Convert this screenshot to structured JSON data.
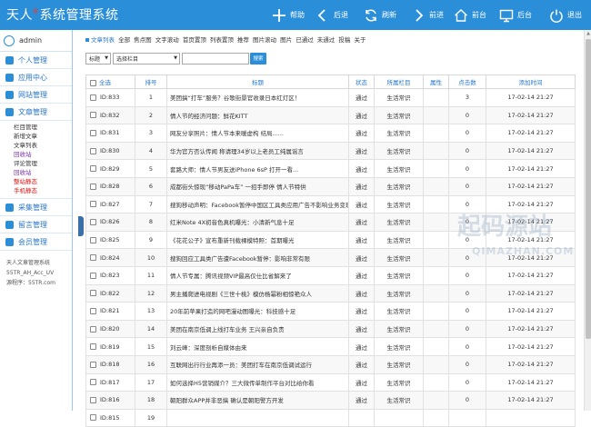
{
  "app": {
    "title_prefix": "天人",
    "title_mark": "®",
    "title_suffix": "系统管理系统"
  },
  "toolbar": [
    {
      "label": "帮助",
      "icon": "plus-icon",
      "name": "help"
    },
    {
      "label": "后退",
      "icon": "back-arrow-icon",
      "name": "back"
    },
    {
      "label": "刷新",
      "icon": "refresh-icon",
      "name": "refresh"
    },
    {
      "label": "前进",
      "icon": "forward-arrow-icon",
      "name": "forward"
    },
    {
      "label": "前台",
      "icon": "home-icon",
      "name": "frontend"
    },
    {
      "label": "后台",
      "icon": "monitor-icon",
      "name": "backend"
    },
    {
      "label": "退出",
      "icon": "power-icon",
      "name": "logout"
    }
  ],
  "sidebar": {
    "user": "admin",
    "menus": [
      "个人管理",
      "应用中心",
      "网站管理",
      "文章管理"
    ],
    "submenu": [
      "栏目管理",
      "新增文章",
      "文章列表",
      "回收站",
      "评论管理",
      "回收站",
      "整站静态",
      "手机静态"
    ],
    "menus2": [
      "采集管理",
      "留言管理",
      "会员管理"
    ],
    "info": [
      "天人文章管理系统",
      "55TR_AH_Acc_UV",
      "源程序：55TR.com"
    ]
  },
  "breadcrumb": {
    "first": "文章列表",
    "links": [
      "全部",
      "焦点图",
      "文字滚动",
      "首页置顶",
      "列表置顶",
      "推荐",
      "图片滚动",
      "图片",
      "已通过",
      "未通过",
      "投稿",
      "关于"
    ]
  },
  "filters": {
    "field": "标题",
    "category": "选择栏目",
    "search_label": "搜索"
  },
  "table": {
    "headers": [
      "全选",
      "排号",
      "标题",
      "状态",
      "所属栏目",
      "属性",
      "点击数",
      "添加时间"
    ],
    "rows": [
      {
        "id": "ID:833",
        "no": "1",
        "title": "美团搞“打车”服务？谷歌街景官收录日本红灯区！",
        "status": "通过",
        "category": "生活常识",
        "attr": "",
        "clicks": "3",
        "time": "17-02-14 21:27"
      },
      {
        "id": "ID:832",
        "no": "2",
        "title": "情人节的经济问题：鲜花KITT",
        "status": "通过",
        "category": "生活常识",
        "attr": "",
        "clicks": "0",
        "time": "17-02-14 21:27"
      },
      {
        "id": "ID:831",
        "no": "3",
        "title": "网友分享照片：情人节本来暖虚构 结局......",
        "status": "通过",
        "category": "生活常识",
        "attr": "",
        "clicks": "0",
        "time": "17-02-14 21:27"
      },
      {
        "id": "ID:830",
        "no": "4",
        "title": "华为官方否认传闻 称请理34岁以上老员工纯属谣言",
        "status": "通过",
        "category": "生活常识",
        "attr": "",
        "clicks": "0",
        "time": "17-02-14 21:27"
      },
      {
        "id": "ID:829",
        "no": "5",
        "title": "套路大师：情人节男友送iPhone 6sP 打开一看...",
        "status": "通过",
        "category": "生活常识",
        "attr": "",
        "clicks": "0",
        "time": "17-02-14 21:27"
      },
      {
        "id": "ID:828",
        "no": "6",
        "title": "成都街头惊现“移动PaPa车” 一招手即停 情人节特供",
        "status": "通过",
        "category": "生活常识",
        "attr": "",
        "clicks": "0",
        "time": "17-02-14 21:27"
      },
      {
        "id": "ID:827",
        "no": "7",
        "title": "搜狗移动声明：Facebook暂停中国区工具类应用广告不影响业务变现",
        "status": "通过",
        "category": "生活常识",
        "attr": "",
        "clicks": "0",
        "time": "17-02-14 21:27"
      },
      {
        "id": "ID:826",
        "no": "8",
        "title": "红米Note 4X初音色真机曝光：小清新气息十足",
        "status": "通过",
        "category": "生活常识",
        "attr": "",
        "clicks": "0",
        "time": "17-02-14 21:27"
      },
      {
        "id": "ID:825",
        "no": "9",
        "title": "《花花公子》宣布重新刊载裸模特照：首期曝光",
        "status": "通过",
        "category": "生活常识",
        "attr": "",
        "clicks": "0",
        "time": "17-02-14 21:27"
      },
      {
        "id": "ID:824",
        "no": "10",
        "title": "搜狗回应工具类广告遭Facebook暂停：影响非常有限",
        "status": "通过",
        "category": "生活常识",
        "attr": "",
        "clicks": "0",
        "time": "17-02-14 21:27"
      },
      {
        "id": "ID:823",
        "no": "11",
        "title": "情人节专属：腾讯视频VIP最高仅仕比省解来了",
        "status": "通过",
        "category": "生活常识",
        "attr": "",
        "clicks": "0",
        "time": "17-02-14 21:27"
      },
      {
        "id": "ID:822",
        "no": "12",
        "title": "男主播爬进电视剧《三世十桃》模仿杨幂粉相惊艳众人",
        "status": "通过",
        "category": "生活常识",
        "attr": "",
        "clicks": "0",
        "time": "17-02-14 21:27"
      },
      {
        "id": "ID:821",
        "no": "13",
        "title": "20年前苹果打造的网吧漫动图曝光：科技感十足",
        "status": "通过",
        "category": "生活常识",
        "attr": "",
        "clicks": "0",
        "time": "17-02-14 21:27"
      },
      {
        "id": "ID:820",
        "no": "14",
        "title": "美团在南京低调上线打车业务 王兴亲自负责",
        "status": "通过",
        "category": "生活常识",
        "attr": "",
        "clicks": "0",
        "time": "17-02-14 21:27"
      },
      {
        "id": "ID:819",
        "no": "15",
        "title": "刘云峰：深度剖析自媒体由来",
        "status": "通过",
        "category": "生活常识",
        "attr": "",
        "clicks": "0",
        "time": "17-02-14 21:27"
      },
      {
        "id": "ID:818",
        "no": "16",
        "title": "互联网出行行业再添一员：美团打车在南京低调试运行",
        "status": "通过",
        "category": "生活常识",
        "attr": "",
        "clicks": "0",
        "time": "17-02-14 21:27"
      },
      {
        "id": "ID:817",
        "no": "17",
        "title": "如何选择H5营销媒介？三大微传单制作平台对比给你看",
        "status": "通过",
        "category": "生活常识",
        "attr": "",
        "clicks": "0",
        "time": "17-02-14 21:27"
      },
      {
        "id": "ID:816",
        "no": "18",
        "title": "朝阳群众APP并非恶搞 确认是朝阳警方开发",
        "status": "通过",
        "category": "生活常识",
        "attr": "",
        "clicks": "0",
        "time": "17-02-14 21:27"
      },
      {
        "id": "ID:815",
        "no": "19",
        "title": "",
        "status": "",
        "category": "",
        "attr": "",
        "clicks": "",
        "time": ""
      }
    ]
  },
  "watermark": {
    "text1": "起码源站",
    "text2": "QIMAZHAN.COM"
  },
  "colors": {
    "header": "#2a8fd8",
    "link": "#2a77c9",
    "accent_red": "#e01515",
    "purple": "#7b2fb3"
  }
}
